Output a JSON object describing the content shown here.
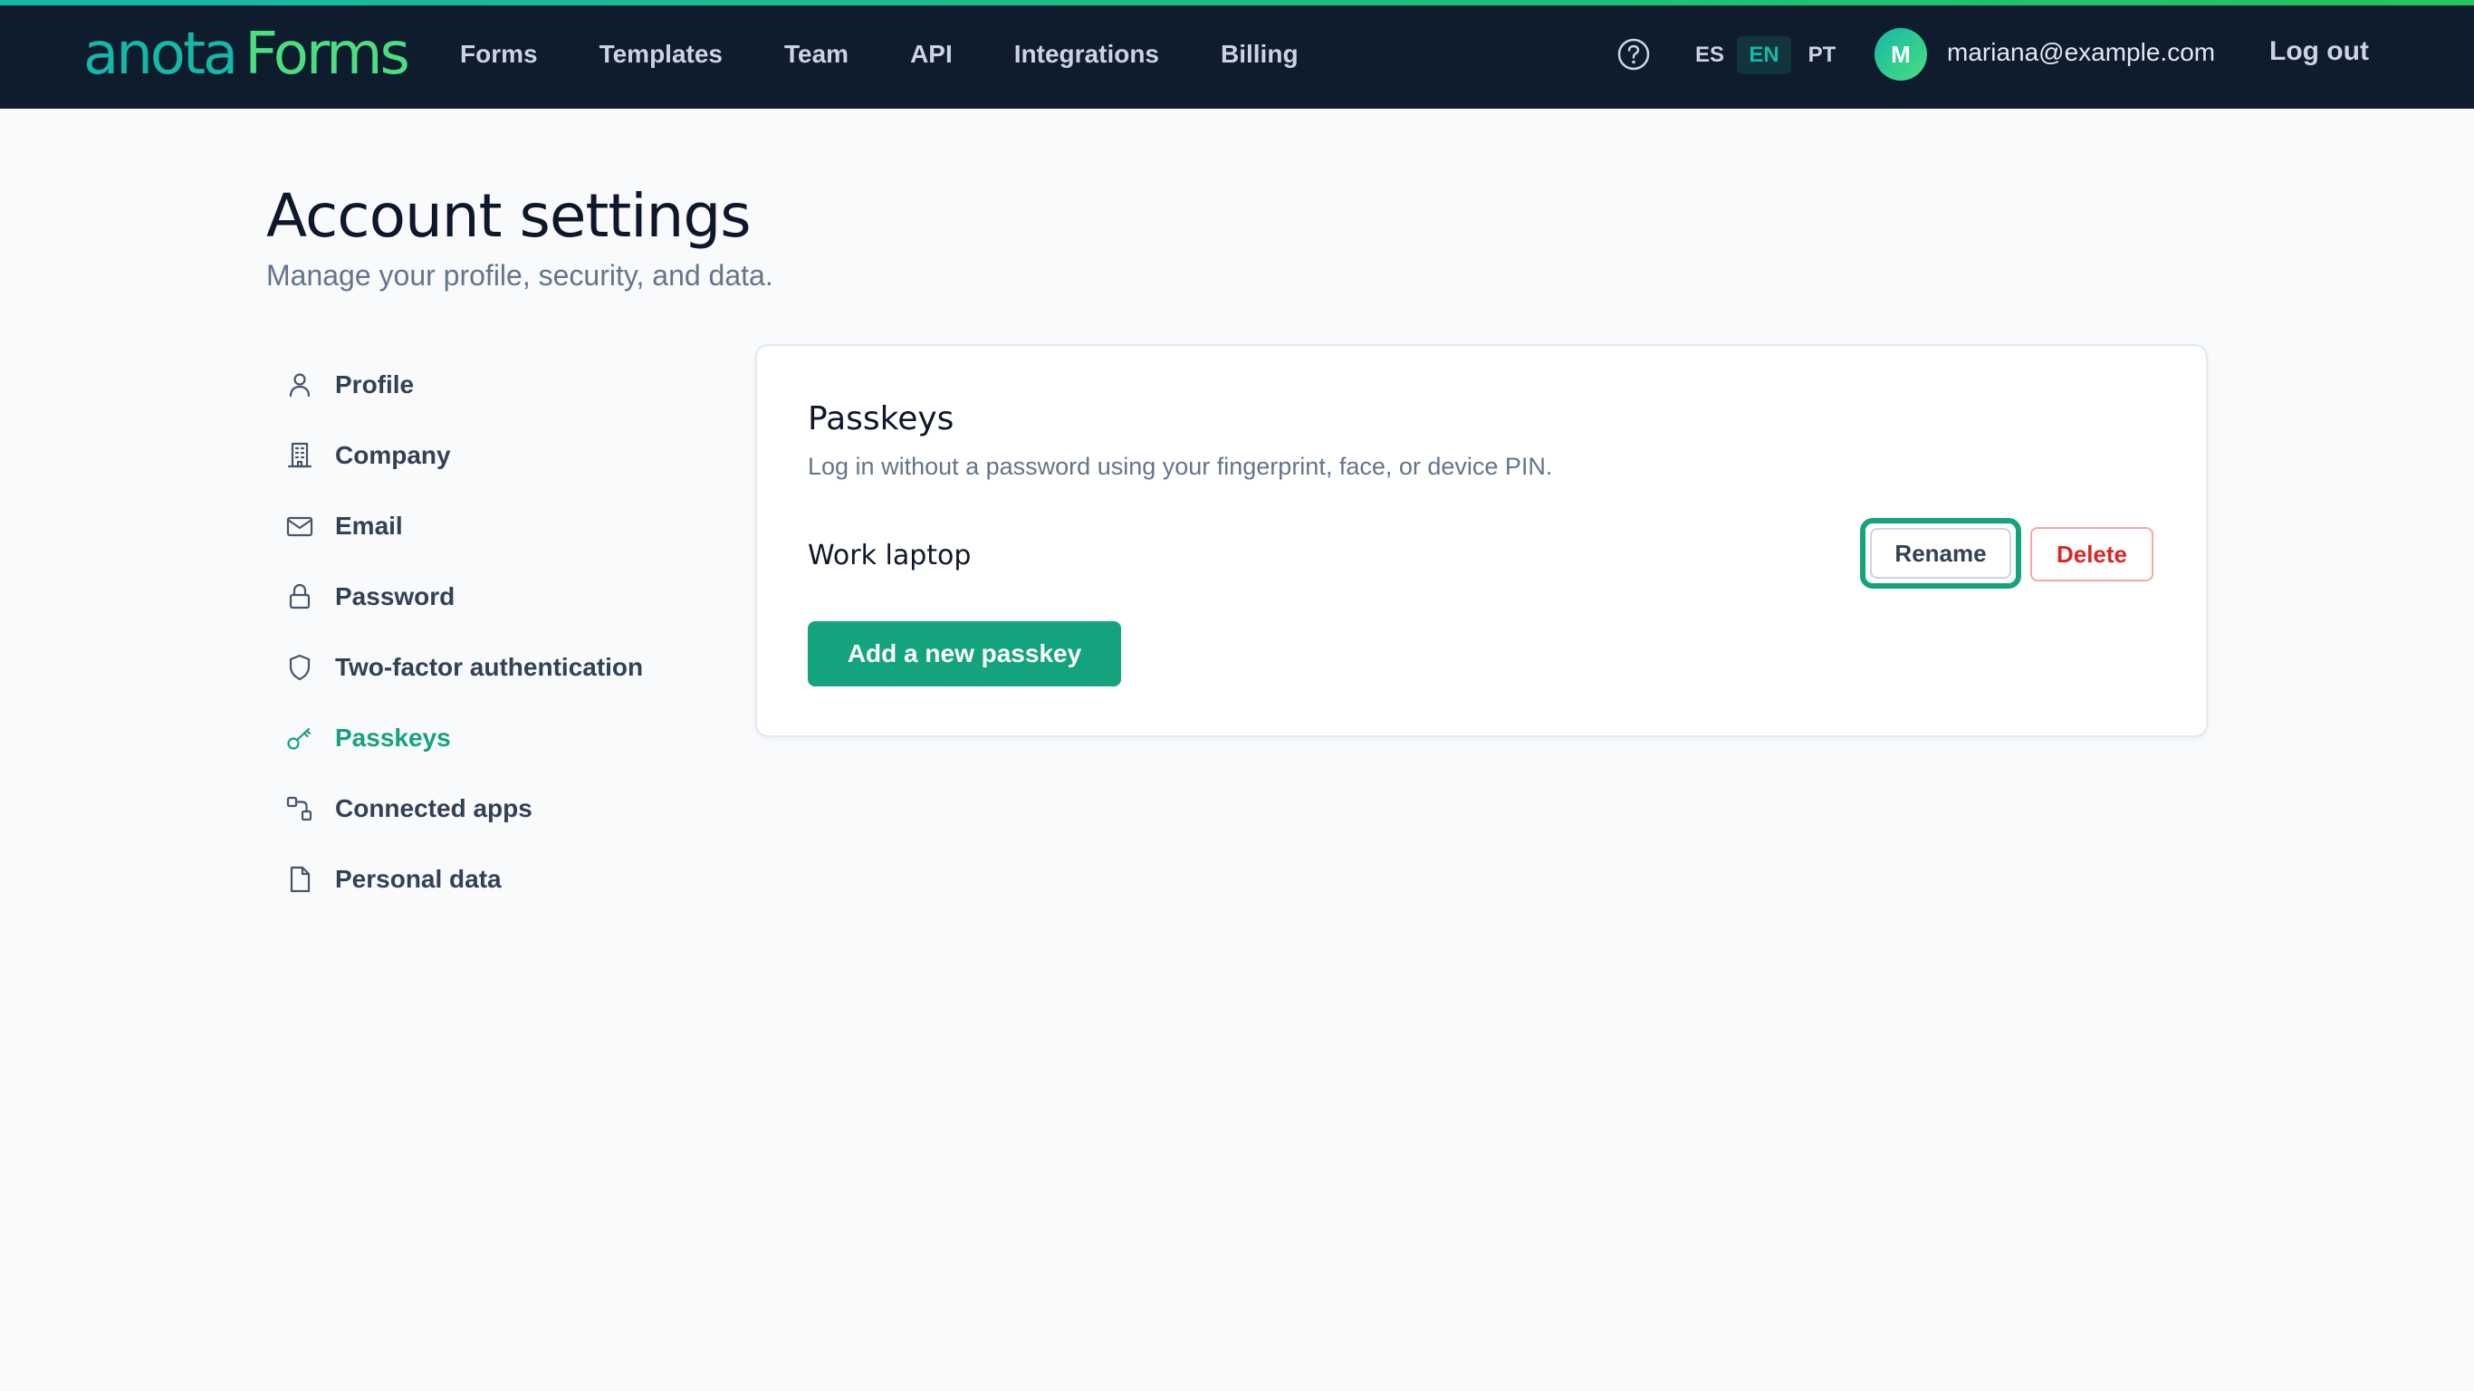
{
  "app": {
    "logo_part1": "anota",
    "logo_part2": "Forms",
    "brand_color": "#14b8a6",
    "accent_color": "#14a37f",
    "danger_color": "#dc2626"
  },
  "header": {
    "nav": [
      {
        "label": "Forms"
      },
      {
        "label": "Templates"
      },
      {
        "label": "Team"
      },
      {
        "label": "API"
      },
      {
        "label": "Integrations"
      },
      {
        "label": "Billing"
      }
    ],
    "help_icon": "question-circle-icon",
    "languages": [
      {
        "code": "ES",
        "selected": false
      },
      {
        "code": "EN",
        "selected": true
      },
      {
        "code": "PT",
        "selected": false
      }
    ],
    "avatar_initial": "M",
    "user_email": "mariana@example.com",
    "logout_label": "Log out"
  },
  "page": {
    "title": "Account settings",
    "subtitle": "Manage your profile, security, and data."
  },
  "sidebar": {
    "items": [
      {
        "label": "Profile",
        "icon": "user-icon",
        "active": false
      },
      {
        "label": "Company",
        "icon": "building-icon",
        "active": false
      },
      {
        "label": "Email",
        "icon": "envelope-icon",
        "active": false
      },
      {
        "label": "Password",
        "icon": "lock-icon",
        "active": false
      },
      {
        "label": "Two-factor authentication",
        "icon": "shield-icon",
        "active": false
      },
      {
        "label": "Passkeys",
        "icon": "key-icon",
        "active": true
      },
      {
        "label": "Connected apps",
        "icon": "link-nodes-icon",
        "active": false
      },
      {
        "label": "Personal data",
        "icon": "document-icon",
        "active": false
      }
    ]
  },
  "passkeys": {
    "title": "Passkeys",
    "description": "Log in without a password using your fingerprint, face, or device PIN.",
    "items": [
      {
        "name": "Work laptop",
        "rename_label": "Rename",
        "delete_label": "Delete"
      }
    ],
    "add_label": "Add a new passkey"
  }
}
